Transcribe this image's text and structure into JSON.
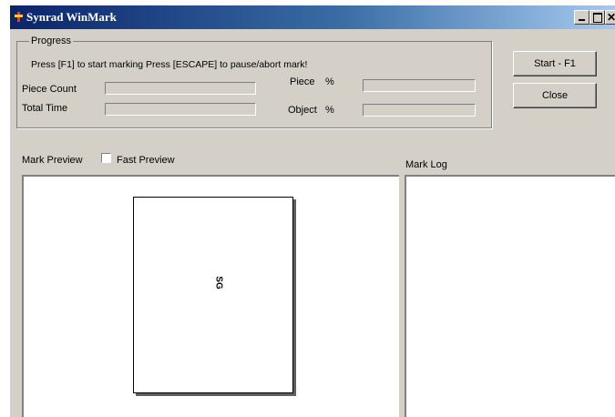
{
  "window": {
    "title": "Synrad WinMark"
  },
  "progress": {
    "group_label": "Progress",
    "instructions": "Press [F1] to start marking   Press [ESCAPE] to pause/abort mark!",
    "piece_count_label": "Piece Count",
    "total_time_label": "Total Time",
    "piece_label": "Piece",
    "object_label": "Object",
    "percent_symbol": "%"
  },
  "buttons": {
    "start_label": "Start - F1",
    "close_label": "Close"
  },
  "preview": {
    "label": "Mark Preview",
    "fast_preview_label": "Fast Preview",
    "fast_preview_checked": false,
    "mark_text": "SG"
  },
  "log": {
    "label": "Mark Log"
  },
  "icons": {
    "app": "winmark-app-icon",
    "minimize": "minimize-icon",
    "maximize": "maximize-icon",
    "close": "close-icon"
  }
}
